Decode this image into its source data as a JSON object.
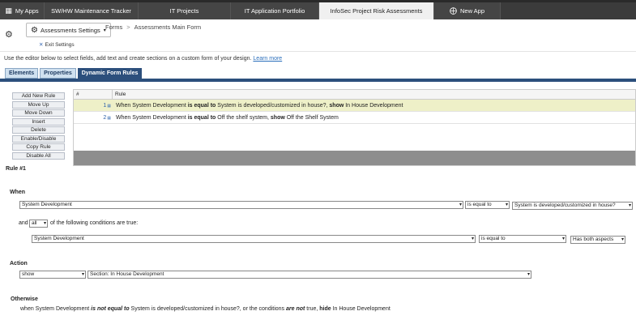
{
  "tabs": [
    {
      "label": "My Apps",
      "icon": "grid-icon",
      "w": 55
    },
    {
      "label": "SW/HW Maintenance Tracker",
      "w": 116
    },
    {
      "label": "IT Projects",
      "w": 114
    },
    {
      "label": "IT Application Portfolio",
      "w": 109
    },
    {
      "label": "InfoSec Project Risk Assessments",
      "w": 142,
      "active": true
    },
    {
      "label": "New App",
      "icon": "new-app-icon",
      "w": 82
    }
  ],
  "header": {
    "settings_label": "Assessments Settings",
    "exit_label": "Exit Settings",
    "crumbs": [
      "Forms",
      "Assessments Main Form"
    ]
  },
  "intro": {
    "text": "Use the editor below to select fields, add text and create sections on a custom form of your design.",
    "link": "Learn more"
  },
  "editor_tabs": [
    "Elements",
    "Properties",
    "Dynamic Form Rules"
  ],
  "buttons": [
    "Add New Rule",
    "Move Up",
    "Move Down",
    "Insert",
    "Delete",
    "Enable/Disable",
    "Copy Rule",
    "Disable All"
  ],
  "grid": {
    "col_num": "#",
    "col_rule": "Rule",
    "rows": [
      {
        "num": "1",
        "a": "When System Development ",
        "b": "is equal to",
        "c": " System is developed/customized in house?, ",
        "d": "show",
        "e": " In House Development"
      },
      {
        "num": "2",
        "a": "When System Development ",
        "b": "is equal to",
        "c": " Off the shelf system, ",
        "d": "show",
        "e": " Off the Shelf System"
      }
    ]
  },
  "rule": {
    "title": "Rule #1",
    "when_label": "When",
    "when_field": "System Development",
    "when_op": "is equal to",
    "when_value": "System is developed/customized in house?",
    "and_pre": "and",
    "and_sel": "all",
    "and_post": "of the following conditions are true:",
    "cond_field": "System Development",
    "cond_op": "is equal to",
    "cond_value": "Has both aspects",
    "action_label": "Action",
    "action_sel": "show",
    "action_target": "Section: In House Development",
    "otherwise_label": "Otherwise",
    "ow_1": "when System Development ",
    "ow_2": "is not equal to",
    "ow_3": " System is developed/customized in house?, or the conditions ",
    "ow_4": "are not",
    "ow_5": " true, ",
    "ow_6": "hide",
    "ow_7": " In House Development"
  }
}
